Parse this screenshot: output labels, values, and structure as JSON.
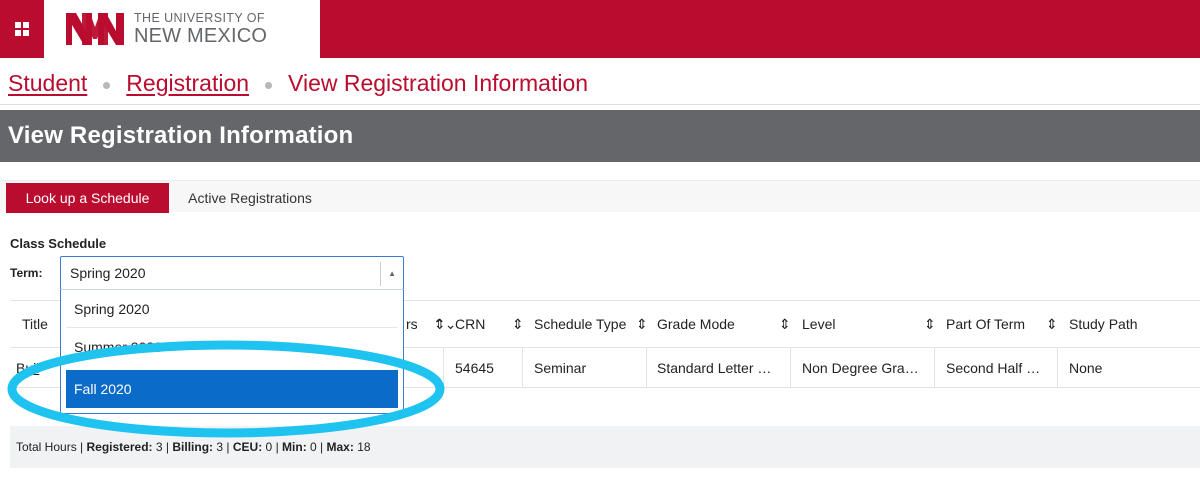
{
  "header": {
    "logo_line1": "THE UNIVERSITY OF",
    "logo_line2": "NEW MEXICO",
    "brand_color": "#ba0c2f",
    "icons": {
      "menu": "grid-icon",
      "logo": "unm-logo-icon"
    }
  },
  "breadcrumb": {
    "items": [
      "Student",
      "Registration"
    ],
    "current": "View Registration Information"
  },
  "page": {
    "title": "View Registration Information"
  },
  "tabs": [
    {
      "label": "Look up a Schedule",
      "active": true
    },
    {
      "label": "Active Registrations",
      "active": false
    }
  ],
  "schedule": {
    "section_label": "Class Schedule",
    "term_label": "Term:",
    "term_value": "Spring 2020",
    "options": [
      "Spring 2020",
      "Summer 2020",
      "Fall 2020"
    ],
    "selected_highlight": "Fall 2020"
  },
  "table": {
    "headers": {
      "title": "Title",
      "hours_partial": "rs",
      "crn": "CRN",
      "schedule_type": "Schedule Type",
      "grade_mode": "Grade Mode",
      "level": "Level",
      "part_of_term": "Part Of Term",
      "study_path": "Study Path"
    },
    "row": {
      "title_partial": "Buil",
      "crn": "54645",
      "schedule_type": "Seminar",
      "grade_mode": "Standard Letter …",
      "level": "Non Degree Gra…",
      "part_of_term": "Second Half …",
      "study_path": "None"
    }
  },
  "footer": {
    "total_hours": "Total Hours",
    "registered_label": "Registered:",
    "registered_value": "3",
    "billing_label": "Billing:",
    "billing_value": "3",
    "ceu_label": "CEU:",
    "ceu_value": "0",
    "min_label": "Min:",
    "min_value": "0",
    "max_label": "Max:",
    "max_value": "18"
  },
  "annotation": {
    "ellipse_color": "#1ec3f0"
  }
}
